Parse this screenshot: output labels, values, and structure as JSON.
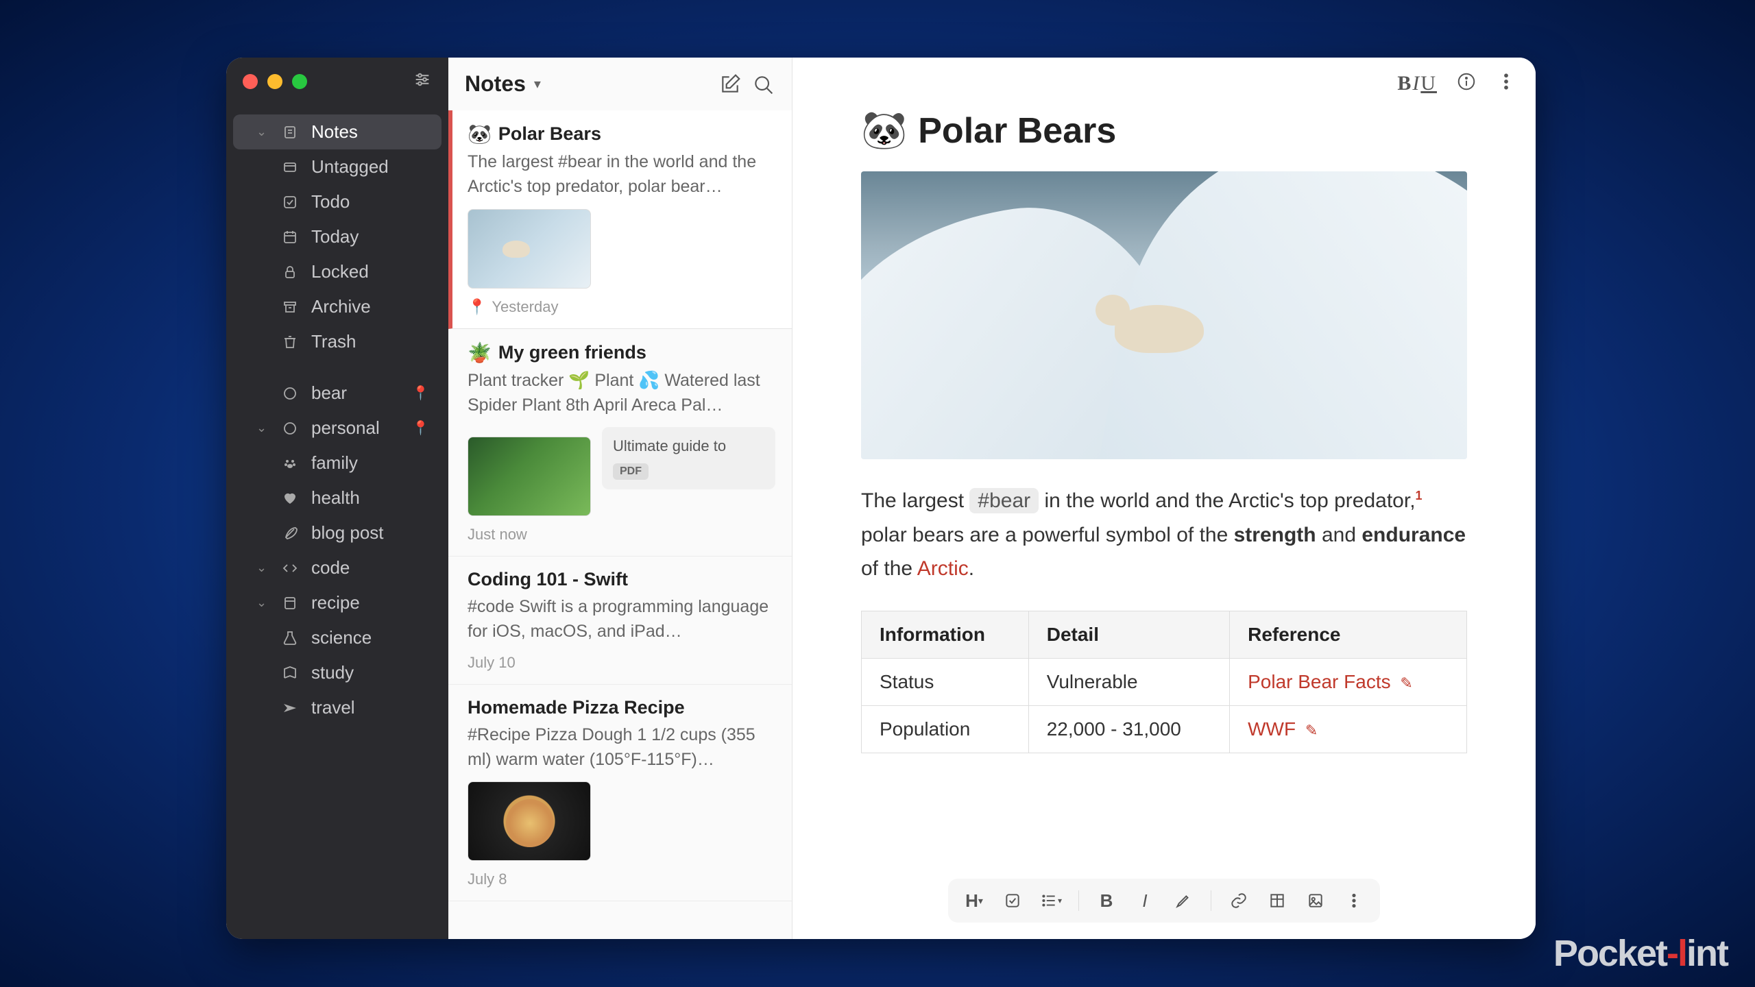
{
  "sidebar": {
    "mainItems": [
      {
        "label": "Notes",
        "icon": "note",
        "selected": true,
        "hasChev": true
      },
      {
        "label": "Untagged",
        "icon": "tag",
        "sub": true
      },
      {
        "label": "Todo",
        "icon": "check",
        "sub": true
      },
      {
        "label": "Today",
        "icon": "calendar",
        "sub": true
      },
      {
        "label": "Locked",
        "icon": "lock",
        "sub": true
      },
      {
        "label": "Archive",
        "icon": "archive"
      },
      {
        "label": "Trash",
        "icon": "trash"
      }
    ],
    "tags": [
      {
        "label": "bear",
        "icon": "tagcircle",
        "pin": true
      },
      {
        "label": "personal",
        "icon": "tagcircle",
        "hasChev": true,
        "pin": true
      },
      {
        "label": "family",
        "icon": "paw",
        "sub": true
      },
      {
        "label": "health",
        "icon": "heart",
        "sub": true
      },
      {
        "label": "blog post",
        "icon": "feather"
      },
      {
        "label": "code",
        "icon": "code",
        "hasChev": true,
        "chevClosed": true
      },
      {
        "label": "recipe",
        "icon": "recipe",
        "hasChev": true,
        "chevClosed": true
      },
      {
        "label": "science",
        "icon": "flask"
      },
      {
        "label": "study",
        "icon": "study"
      },
      {
        "label": "travel",
        "icon": "plane"
      }
    ]
  },
  "listHeader": {
    "title": "Notes"
  },
  "notes": [
    {
      "emoji": "🐼",
      "title": "Polar Bears",
      "preview": "The largest #bear in the world and the Arctic's top predator, polar bear…",
      "date": "Yesterday",
      "pinned": true,
      "thumb": "bear",
      "active": true
    },
    {
      "emoji": "🪴",
      "title": "My green friends",
      "preview": "Plant tracker 🌱 Plant 💦 Watered last Spider Plant 8th April Areca Pal…",
      "date": "Just now",
      "thumb": "plant",
      "attachment": {
        "title": "Ultimate guide to",
        "badge": "PDF"
      }
    },
    {
      "title": "Coding 101 - Swift",
      "preview": "#code Swift is a programming language for iOS, macOS, and iPad…",
      "date": "July 10"
    },
    {
      "title": "Homemade Pizza Recipe",
      "preview": "#Recipe Pizza Dough 1 1/2 cups (355 ml) warm water (105°F-115°F)…",
      "date": "July 8",
      "thumb": "pizza"
    }
  ],
  "doc": {
    "emoji": "🐼",
    "title": "Polar Bears",
    "para_pre": "The largest ",
    "para_tag": "#bear",
    "para_mid": " in the world and the Arctic's top predator,",
    "para_sup": "1",
    "para_line2_pre": "polar bears are a powerful symbol of the ",
    "para_line2_b1": "strength",
    "para_line2_mid": " and ",
    "para_line2_b2": "endurance",
    "para_line3_pre": " of the ",
    "para_line3_link": "Arctic",
    "para_line3_post": ".",
    "table": {
      "headers": [
        "Information",
        "Detail",
        "Reference"
      ],
      "rows": [
        {
          "info": "Status",
          "detail": "Vulnerable",
          "ref": "Polar Bear Facts"
        },
        {
          "info": "Population",
          "detail": "22,000 - 31,000",
          "ref": "WWF"
        }
      ]
    }
  },
  "watermark": {
    "pre": "Pocket",
    "mid": "-l",
    "post": "int"
  }
}
